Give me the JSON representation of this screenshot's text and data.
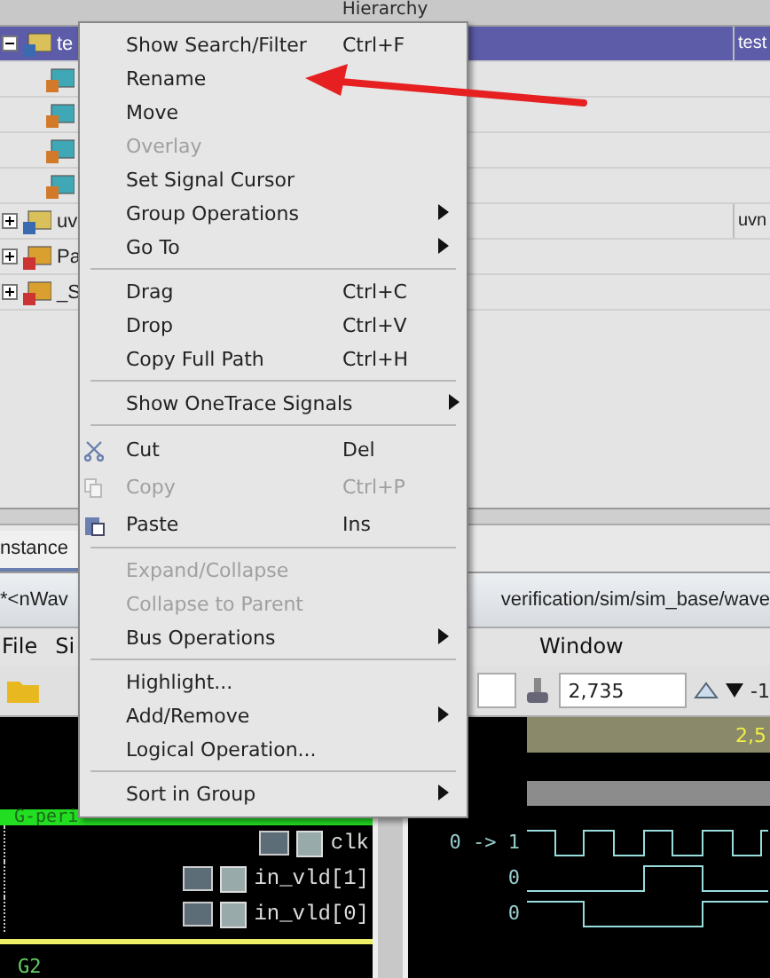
{
  "hierarchy": {
    "title": "Hierarchy",
    "rows": [
      {
        "label": "te",
        "value": "test",
        "kind": "module",
        "selected": true,
        "expanded": true,
        "children": [
          {
            "kind": "instance"
          },
          {
            "kind": "instance"
          },
          {
            "kind": "instance"
          },
          {
            "kind": "instance"
          }
        ]
      },
      {
        "label": "uv",
        "value": "uvn",
        "kind": "module",
        "selected": false,
        "expanded": false
      },
      {
        "label": "Pa",
        "kind": "package",
        "selected": false,
        "expanded": false
      },
      {
        "label": "_S",
        "kind": "package",
        "selected": false,
        "expanded": false
      }
    ]
  },
  "tab": {
    "label": "nstance"
  },
  "title_bar": {
    "left": "*<nWav",
    "right": "verification/sim/sim_base/wave"
  },
  "menubar": {
    "left": [
      "File",
      "Si"
    ],
    "right": [
      "Window"
    ]
  },
  "toolbar": {
    "cursor_time": "2,735",
    "step": "-1"
  },
  "ruler": {
    "label": "2,5"
  },
  "groups": [
    {
      "name": "G-peri",
      "color": "#22dd22",
      "signals": [
        {
          "name": "clk",
          "value": "0 -> 1"
        },
        {
          "name": "in_vld[1]",
          "value": "0"
        },
        {
          "name": "in_vld[0]",
          "value": "0"
        }
      ]
    },
    {
      "name": "G2",
      "color": "#eeee66"
    }
  ],
  "context_menu": [
    {
      "kind": "item",
      "label": "Show Search/Filter",
      "shortcut": "Ctrl+F",
      "disabled": false,
      "submenu": false
    },
    {
      "kind": "item",
      "label": "Rename",
      "disabled": false,
      "submenu": false
    },
    {
      "kind": "item",
      "label": "Move",
      "disabled": false,
      "submenu": false
    },
    {
      "kind": "item",
      "label": "Overlay",
      "disabled": true,
      "submenu": false
    },
    {
      "kind": "item",
      "label": "Set Signal Cursor",
      "disabled": false,
      "submenu": false
    },
    {
      "kind": "item",
      "label": "Group Operations",
      "disabled": false,
      "submenu": true
    },
    {
      "kind": "item",
      "label": "Go To",
      "disabled": false,
      "submenu": true
    },
    {
      "kind": "separator"
    },
    {
      "kind": "item",
      "label": "Drag",
      "shortcut": "Ctrl+C",
      "disabled": false,
      "submenu": false
    },
    {
      "kind": "item",
      "label": "Drop",
      "shortcut": "Ctrl+V",
      "disabled": false,
      "submenu": false
    },
    {
      "kind": "item",
      "label": "Copy Full Path",
      "shortcut": "Ctrl+H",
      "disabled": false,
      "submenu": false
    },
    {
      "kind": "separator"
    },
    {
      "kind": "item",
      "label": "Show OneTrace Signals",
      "disabled": false,
      "submenu": true
    },
    {
      "kind": "separator"
    },
    {
      "kind": "item",
      "label": "Cut",
      "shortcut": "Del",
      "disabled": false,
      "submenu": false
    },
    {
      "kind": "item",
      "label": "Copy",
      "shortcut": "Ctrl+P",
      "disabled": true,
      "submenu": false
    },
    {
      "kind": "item",
      "label": "Paste",
      "shortcut": "Ins",
      "disabled": false,
      "submenu": false
    },
    {
      "kind": "separator"
    },
    {
      "kind": "item",
      "label": "Expand/Collapse",
      "disabled": true,
      "submenu": false
    },
    {
      "kind": "item",
      "label": "Collapse to Parent",
      "disabled": true,
      "submenu": false
    },
    {
      "kind": "item",
      "label": "Bus Operations",
      "disabled": false,
      "submenu": true
    },
    {
      "kind": "separator"
    },
    {
      "kind": "item",
      "label": "Highlight...",
      "disabled": false,
      "submenu": false
    },
    {
      "kind": "item",
      "label": "Add/Remove",
      "disabled": false,
      "submenu": true
    },
    {
      "kind": "item",
      "label": "Logical Operation...",
      "disabled": false,
      "submenu": false
    },
    {
      "kind": "separator"
    },
    {
      "kind": "item",
      "label": "Sort in Group",
      "disabled": false,
      "submenu": true
    }
  ]
}
